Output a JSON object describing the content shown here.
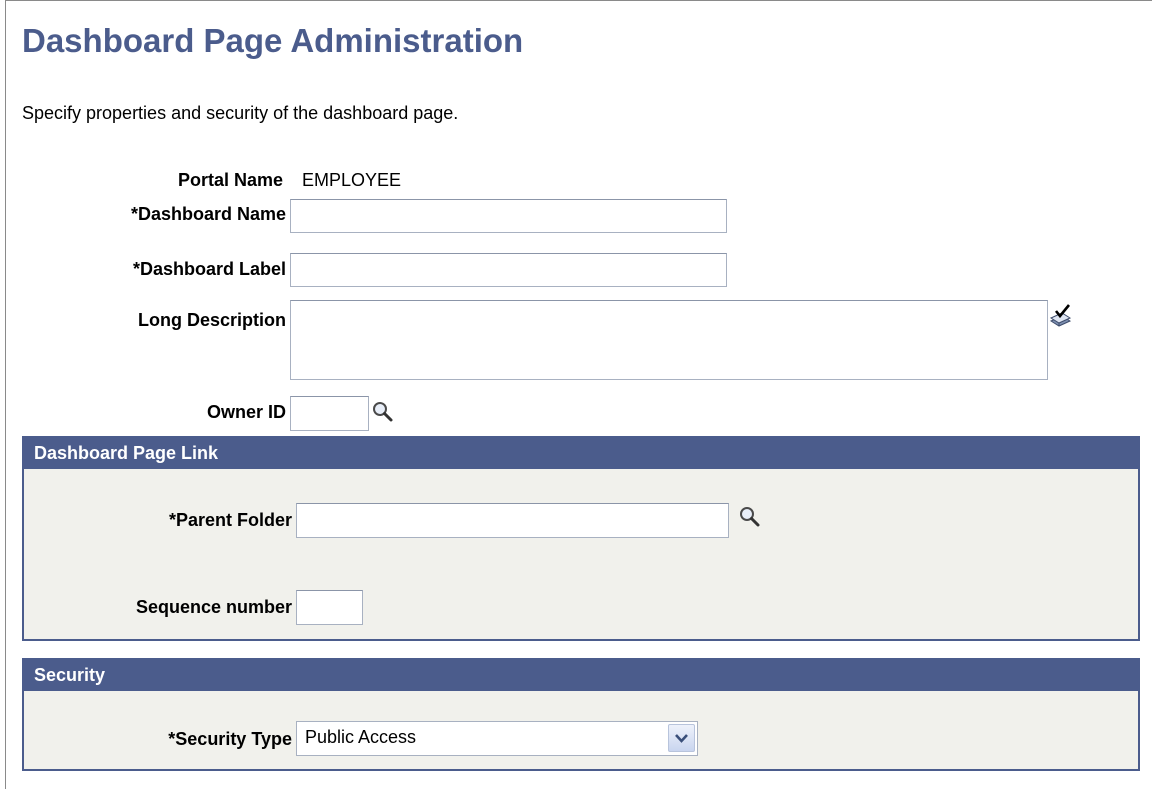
{
  "page": {
    "title": "Dashboard Page Administration",
    "instructions": "Specify properties and security of the dashboard page."
  },
  "form": {
    "portal_name_label": "Portal Name",
    "portal_name_value": "EMPLOYEE",
    "dashboard_name_label": "*Dashboard Name",
    "dashboard_name_value": "",
    "dashboard_label_label": "*Dashboard Label",
    "dashboard_label_value": "",
    "long_description_label": "Long Description",
    "long_description_value": "",
    "owner_id_label": "Owner ID",
    "owner_id_value": ""
  },
  "page_link_section": {
    "title": "Dashboard Page Link",
    "parent_folder_label": "*Parent Folder",
    "parent_folder_value": "",
    "sequence_label": "Sequence number",
    "sequence_value": ""
  },
  "security_section": {
    "title": "Security",
    "security_type_label": "*Security Type",
    "security_type_value": "Public Access"
  },
  "icons": {
    "lookup": "magnifying-glass-lookup-icon",
    "spell_check": "spell-check-icon",
    "dropdown": "chevron-down-icon"
  },
  "colors": {
    "accent": "#4b5c8c",
    "section_bg": "#f1f1ec",
    "input_border": "#a8b1c1"
  }
}
